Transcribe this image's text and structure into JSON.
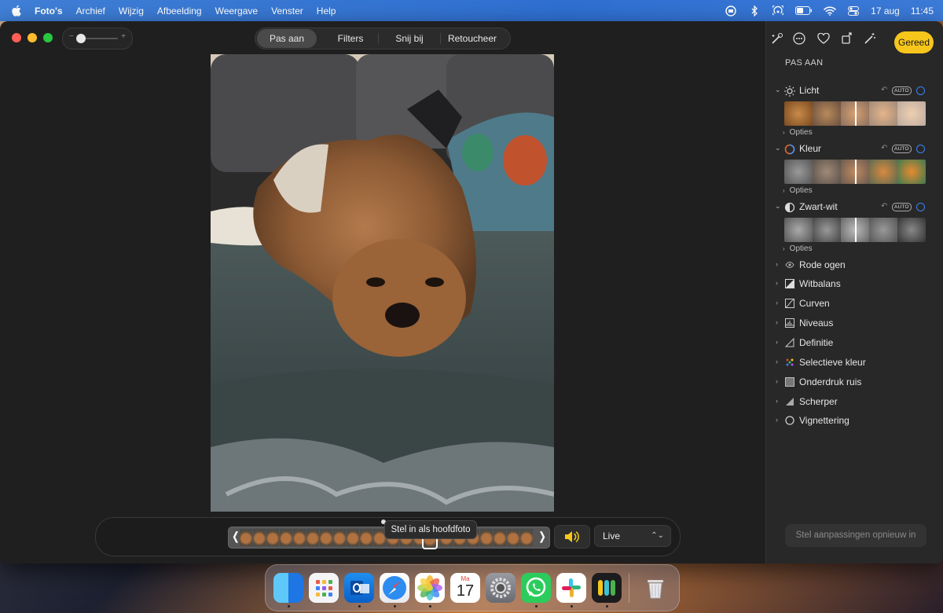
{
  "menubar": {
    "app_name": "Foto's",
    "menus": [
      "Archief",
      "Wijzig",
      "Afbeelding",
      "Weergave",
      "Venster",
      "Help"
    ],
    "date": "17 aug",
    "time": "11:45"
  },
  "toolbar": {
    "tabs": [
      "Pas aan",
      "Filters",
      "Snij bij",
      "Retoucheer"
    ],
    "active_tab": "Pas aan",
    "done_label": "Gereed"
  },
  "sidebar": {
    "heading": "PAS AAN",
    "adjust_sections": [
      {
        "label": "Licht",
        "auto": "AUTO",
        "options": "Opties"
      },
      {
        "label": "Kleur",
        "auto": "AUTO",
        "options": "Opties"
      },
      {
        "label": "Zwart-wit",
        "auto": "AUTO",
        "options": "Opties"
      }
    ],
    "tools": [
      "Rode ogen",
      "Witbalans",
      "Curven",
      "Niveaus",
      "Definitie",
      "Selectieve kleur",
      "Onderdruk ruis",
      "Scherper",
      "Vignettering"
    ],
    "reset_label": "Stel aanpassingen opnieuw in"
  },
  "live": {
    "tooltip": "Stel in als hoofdfoto",
    "mode": "Live"
  },
  "colors": {
    "accent": "#f6c61c",
    "ring": "#3b82f6"
  },
  "dock": {
    "calendar_month": "Ma",
    "calendar_day": "17"
  }
}
